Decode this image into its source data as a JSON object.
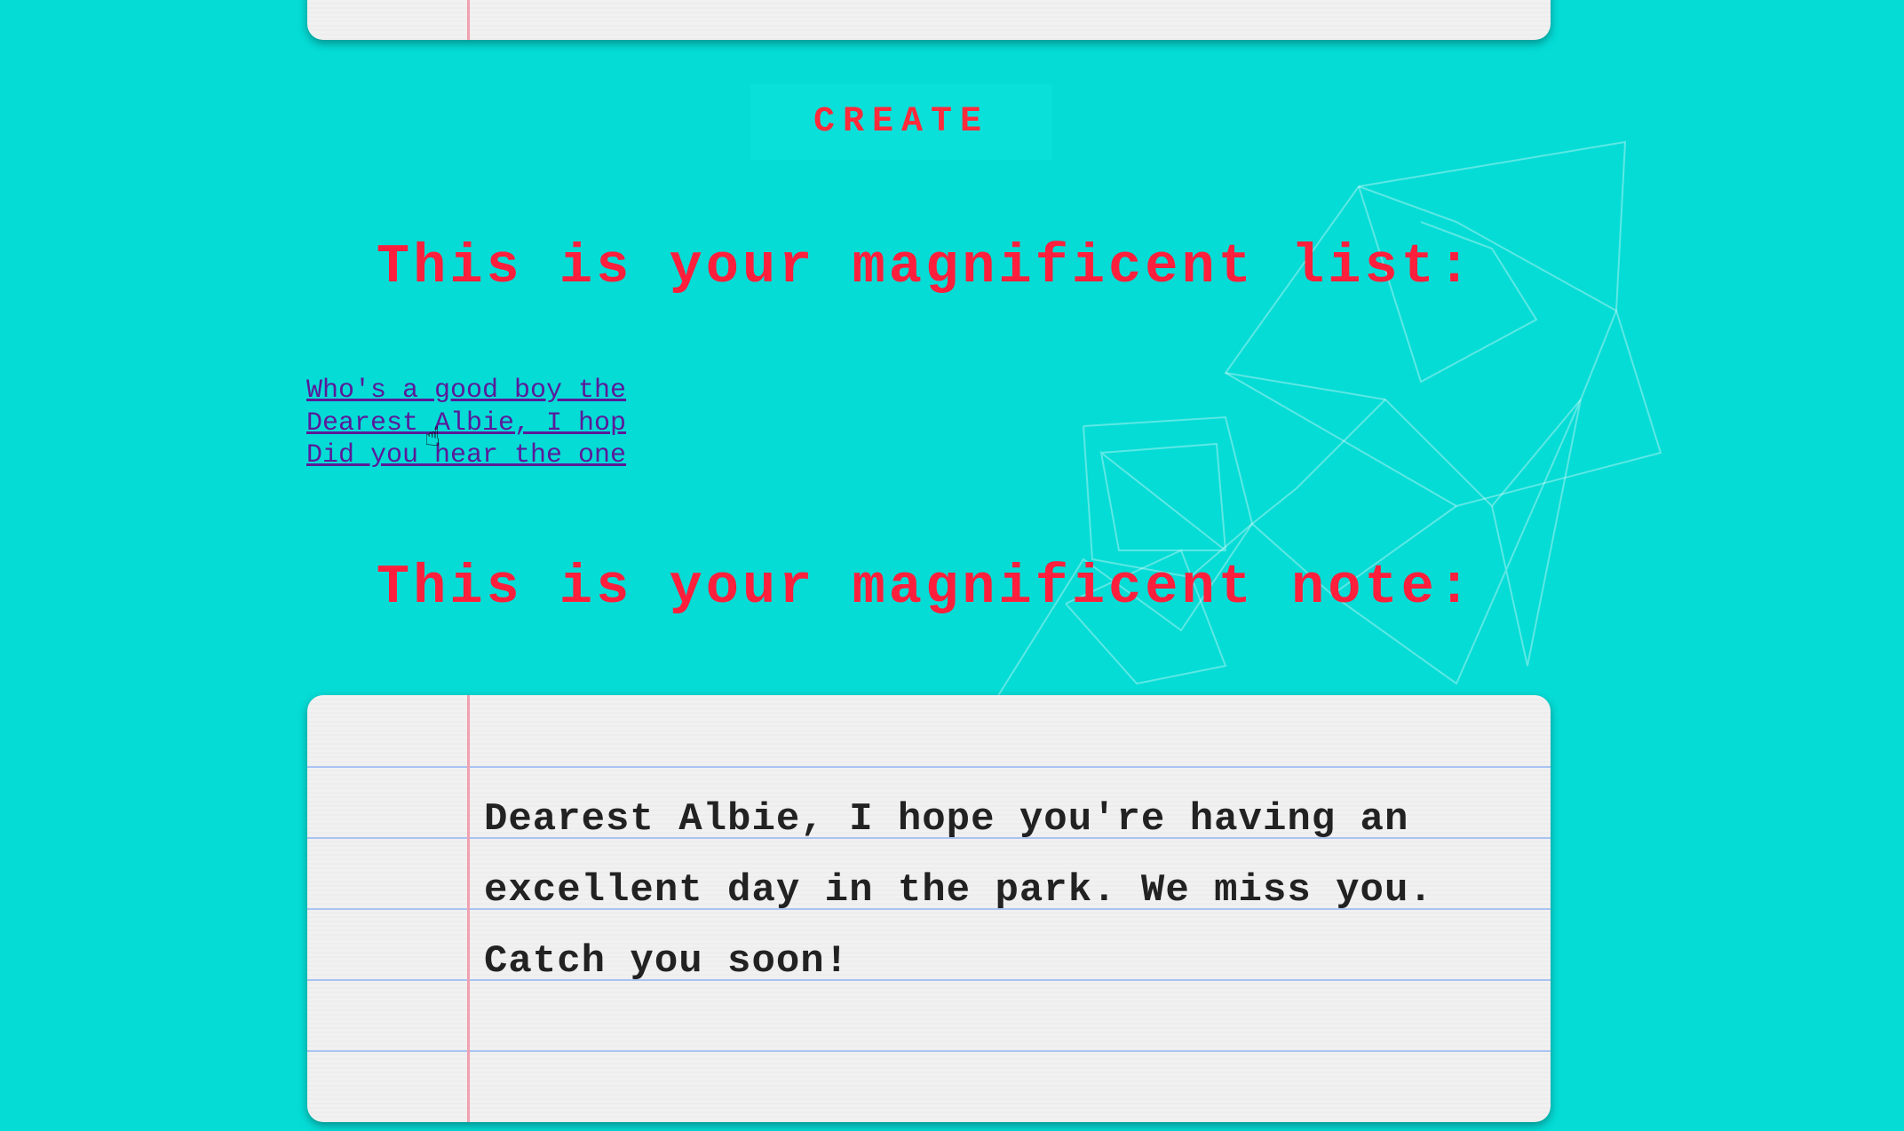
{
  "create_button": {
    "label": "CREATE"
  },
  "list_section": {
    "heading": "This is your magnificent list:",
    "items": [
      "Who's a good boy the",
      "Dearest Albie, I hop",
      "Did you hear the one"
    ]
  },
  "note_section": {
    "heading": "This is your magnificent note:",
    "text": "Dearest Albie, I hope you're having an excellent day in the park. We miss you. Catch you soon!"
  },
  "colors": {
    "background": "#05dcd6",
    "heading": "#ff1f3c",
    "link": "#5b1a99",
    "paper": "#f1f1f1",
    "margin_line": "#f2a0b0",
    "rule_line": "#a9c4f2"
  }
}
